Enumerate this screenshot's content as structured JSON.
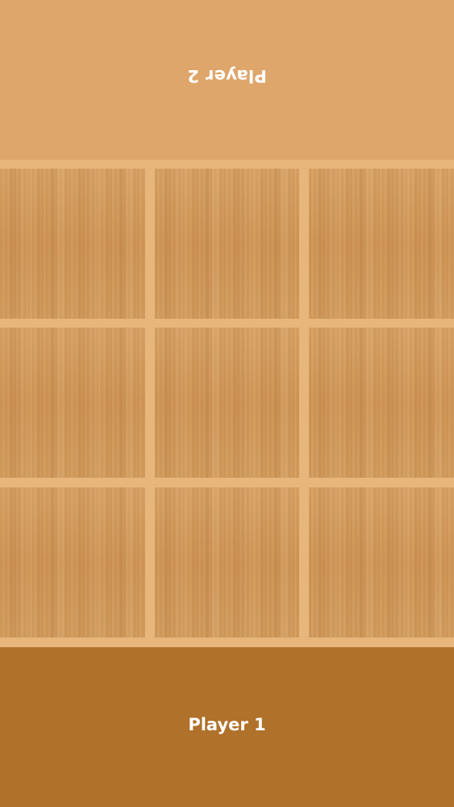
{
  "players": {
    "top_label": "Player 2",
    "bottom_label": "Player 1"
  },
  "board": {
    "rows": 3,
    "cols": 3,
    "cells": [
      "",
      "",
      "",
      "",
      "",
      "",
      "",
      "",
      ""
    ]
  },
  "colors": {
    "top_panel": "#dea66b",
    "bottom_panel": "#b0712b",
    "grid_lines": "#e8b67a",
    "wood": "#d29a5b"
  }
}
